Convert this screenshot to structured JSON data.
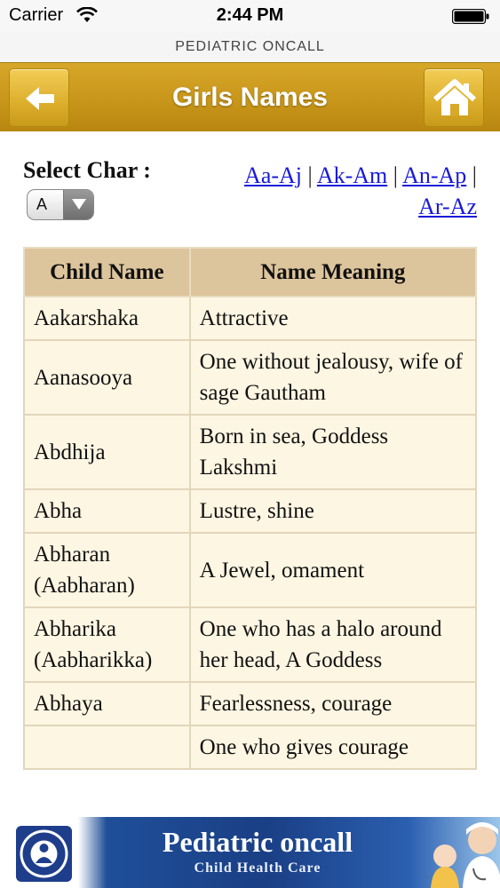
{
  "status_bar": {
    "carrier": "Carrier",
    "time": "2:44 PM",
    "icons": [
      "wifi-icon",
      "battery-icon"
    ]
  },
  "app": {
    "title": "PEDIATRIC ONCALL"
  },
  "header": {
    "title": "Girls Names",
    "back_icon": "arrow-left-icon",
    "home_icon": "home-icon"
  },
  "selector": {
    "label": "Select Char :",
    "selected": "A"
  },
  "ranges": {
    "links": [
      "Aa-Aj",
      "Ak-Am",
      "An-Ap",
      "Ar-Az"
    ],
    "separator": "|"
  },
  "table": {
    "headers": [
      "Child Name",
      "Name Meaning"
    ],
    "rows": [
      {
        "name": "Aakarshaka",
        "meaning": "Attractive"
      },
      {
        "name": "Aanasooya",
        "meaning": "One without jealousy, wife of sage Gautham"
      },
      {
        "name": "Abdhija",
        "meaning": "Born in sea, Goddess Lakshmi"
      },
      {
        "name": "Abha",
        "meaning": "Lustre, shine"
      },
      {
        "name": "Abharan (Aabharan)",
        "meaning": "A Jewel, omament"
      },
      {
        "name": "Abharika (Aabharikka)",
        "meaning": "One who has a halo around her head, A Goddess"
      },
      {
        "name": "Abhaya",
        "meaning": "Fearlessness, courage"
      },
      {
        "name": "",
        "meaning": "One who gives courage"
      }
    ]
  },
  "banner": {
    "title": "Pediatric oncall",
    "subtitle": "Child Health Care"
  },
  "colors": {
    "header_gold": "#c8961a",
    "link_blue": "#1a1ad8",
    "table_header": "#dcc49c",
    "table_cell": "#fdf6e2",
    "banner_blue": "#1a3f85"
  }
}
